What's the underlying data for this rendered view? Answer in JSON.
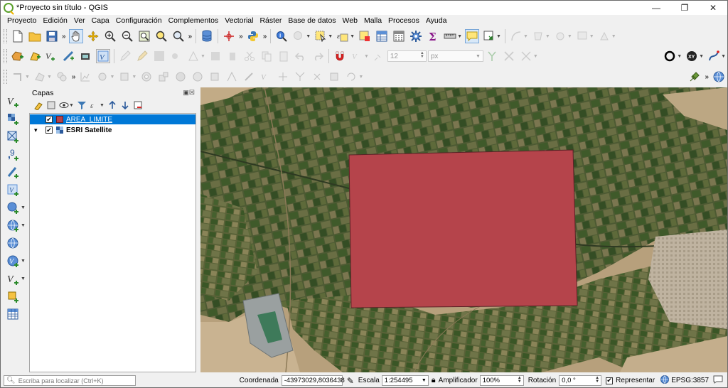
{
  "window": {
    "title": "*Proyecto sin título - QGIS",
    "controls": [
      "—",
      "❐",
      "✕"
    ]
  },
  "menu": [
    "Proyecto",
    "Edición",
    "Ver",
    "Capa",
    "Configuración",
    "Complementos",
    "Vectorial",
    "Ráster",
    "Base de datos",
    "Web",
    "Malla",
    "Procesos",
    "Ayuda"
  ],
  "toolbar": {
    "font_size_value": "12",
    "font_unit": "px",
    "more_label": "»"
  },
  "layers_panel": {
    "title": "Capas",
    "layers": [
      {
        "name": "AREA_LIMITE",
        "checked": true,
        "selected": true,
        "color": "#b5444b"
      },
      {
        "name": "ESRI Satellite",
        "checked": true,
        "selected": false,
        "expander": "▾"
      }
    ]
  },
  "map": {
    "polygon_fill": "#b5444b",
    "polygon_stroke": "#5a2226"
  },
  "status": {
    "locate_placeholder": "Escriba para localizar (Ctrl+K)",
    "coord_label": "Coordenada",
    "coord_value": "-43973029,8036438",
    "scale_label": "Escala",
    "scale_value": "1:254495",
    "magnifier_label": "Amplificador",
    "magnifier_value": "100%",
    "rotation_label": "Rotación",
    "rotation_value": "0,0 °",
    "render_label": "Representar",
    "crs_label": "EPSG:3857"
  }
}
